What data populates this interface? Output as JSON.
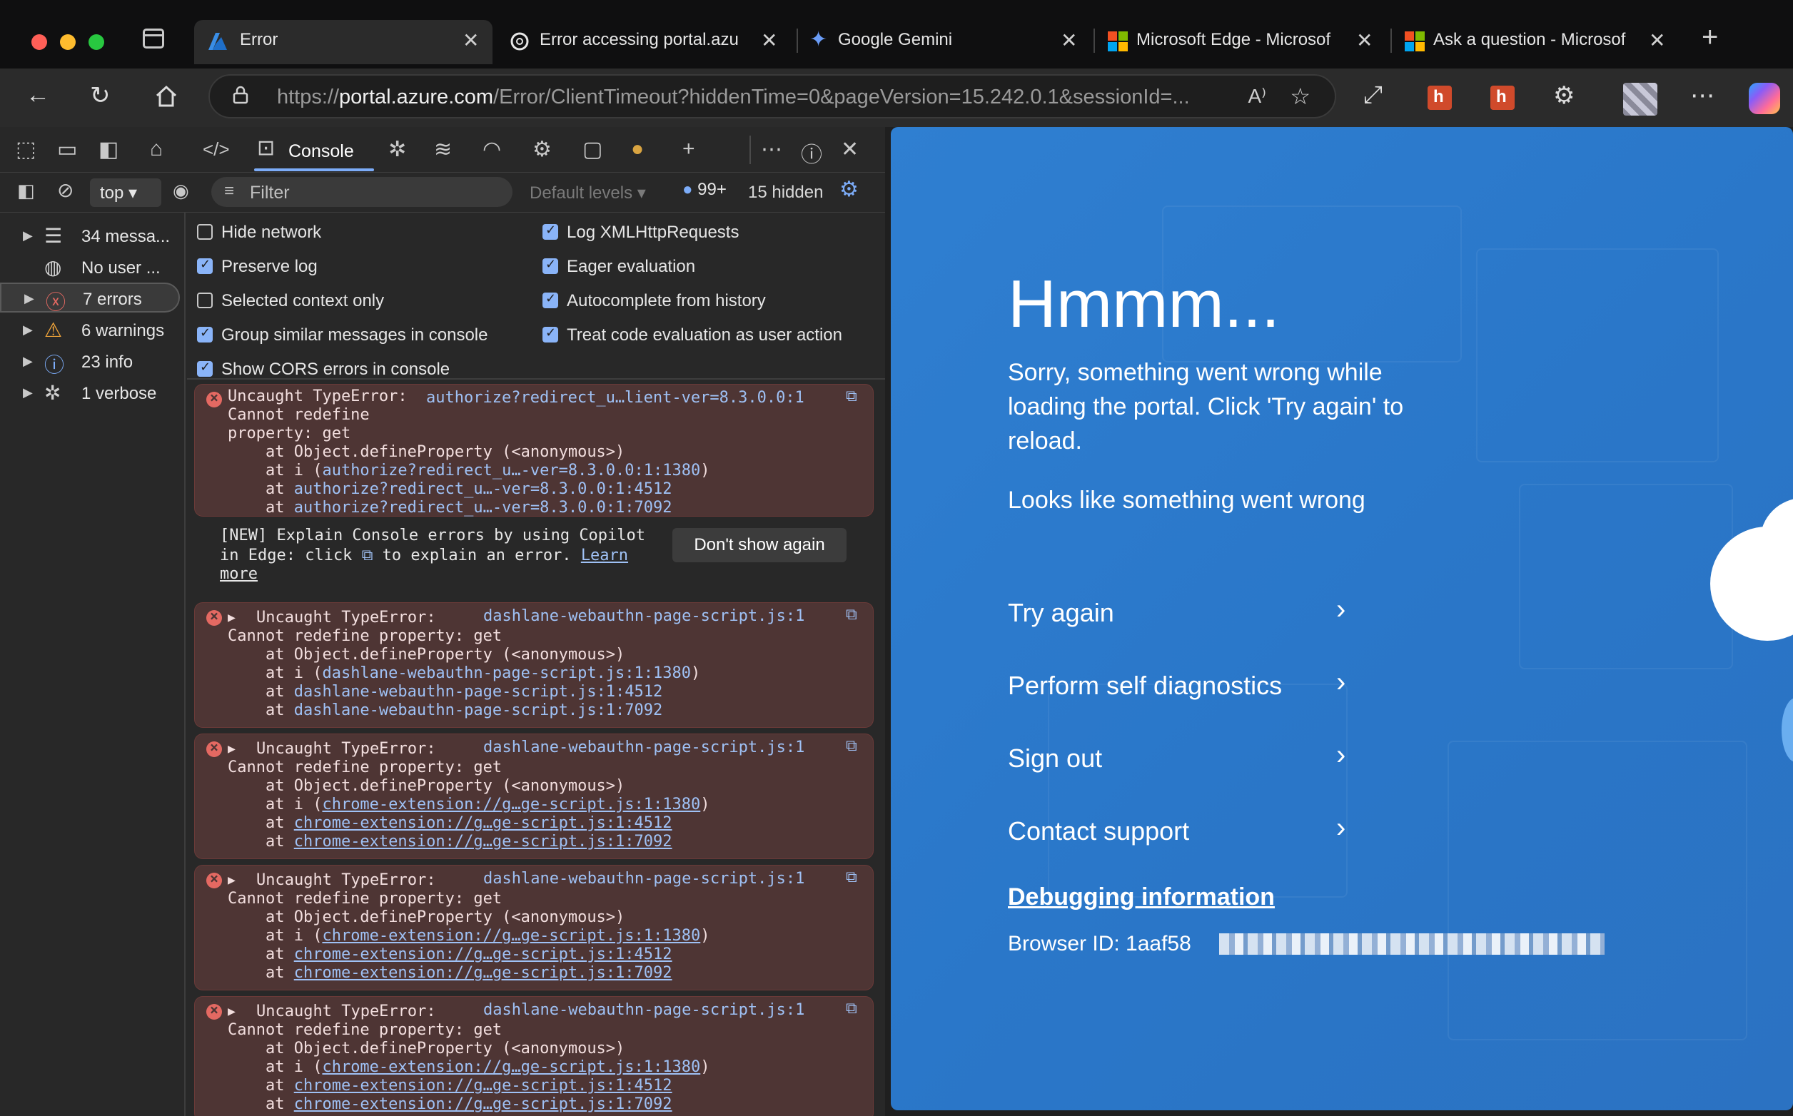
{
  "browser": {
    "tabs": [
      {
        "title": "Error",
        "active": true
      },
      {
        "title": "Error accessing portal.azu"
      },
      {
        "title": "Google Gemini"
      },
      {
        "title": "Microsoft Edge - Microsof"
      },
      {
        "title": "Ask a question - Microsof"
      }
    ],
    "url_scheme": "https://",
    "url_host": "portal.azure.com",
    "url_path": "/Error/ClientTimeout?hiddenTime=0&pageVersion=15.242.0.1&sessionId=..."
  },
  "devtools": {
    "active_tab": "Console",
    "context": "top",
    "filter_placeholder": "Filter",
    "levels": "Default levels",
    "issues_count": "99+",
    "hidden_count": "15 hidden",
    "sidebar": [
      {
        "label": "34 messa...",
        "icon": "list-icon"
      },
      {
        "label": "No user ...",
        "icon": "user-icon"
      },
      {
        "label": "7 errors",
        "icon": "error-icon",
        "selected": true
      },
      {
        "label": "6 warnings",
        "icon": "warning-icon"
      },
      {
        "label": "23 info",
        "icon": "info-icon"
      },
      {
        "label": "1 verbose",
        "icon": "bug-icon"
      }
    ],
    "settings_left": [
      {
        "label": "Hide network",
        "checked": false
      },
      {
        "label": "Preserve log",
        "checked": true
      },
      {
        "label": "Selected context only",
        "checked": false
      },
      {
        "label": "Group similar messages in console",
        "checked": true
      },
      {
        "label": "Show CORS errors in console",
        "checked": true
      }
    ],
    "settings_right": [
      {
        "label": "Log XMLHttpRequests",
        "checked": true
      },
      {
        "label": "Eager evaluation",
        "checked": true
      },
      {
        "label": "Autocomplete from history",
        "checked": true
      },
      {
        "label": "Treat code evaluation as user action",
        "checked": true
      }
    ],
    "first_error": {
      "l1": "Uncaught TypeError:",
      "l2": "Cannot redefine",
      "l3": "property: get",
      "src": "authorize?redirect_u…lient-ver=8.3.0.0:1",
      "s1": "    at Object.defineProperty (<anonymous>)",
      "s2a": "    at i (",
      "s2b": "authorize?redirect_u…-ver=8.3.0.0:1:1380",
      "s2c": ")",
      "s3a": "    at ",
      "s3b": "authorize?redirect_u…-ver=8.3.0.0:1:4512",
      "s4b": "authorize?redirect_u…-ver=8.3.0.0:1:7092"
    },
    "banner": {
      "l1": "[NEW] Explain Console errors by using Copilot",
      "l2a": "in Edge: click ",
      "l2b": " to explain an error. ",
      "learn": "Learn",
      "more": "more",
      "button": "Don't show again"
    },
    "errors": [
      {
        "head": "Uncaught TypeError:",
        "src": "dashlane-webauthn-page-script.js:1",
        "msg": "Cannot redefine property: get",
        "s1": "    at Object.defineProperty (<anonymous>)",
        "s2a": "    at i (",
        "s2b": "dashlane-webauthn-page-script.js:1:1380",
        "s3a": "    at ",
        "s3b": "dashlane-webauthn-page-script.js:1:4512",
        "s4b": "dashlane-webauthn-page-script.js:1:7092",
        "underline": false
      },
      {
        "head": "Uncaught TypeError:",
        "src": "dashlane-webauthn-page-script.js:1",
        "msg": "Cannot redefine property: get",
        "s1": "    at Object.defineProperty (<anonymous>)",
        "s2a": "    at i (",
        "s2b": "chrome-extension://g…ge-script.js:1:1380",
        "s3a": "    at ",
        "s3b": "chrome-extension://g…ge-script.js:1:4512",
        "s4b": "chrome-extension://g…ge-script.js:1:7092",
        "underline": true
      },
      {
        "head": "Uncaught TypeError:",
        "src": "dashlane-webauthn-page-script.js:1",
        "msg": "Cannot redefine property: get",
        "s1": "    at Object.defineProperty (<anonymous>)",
        "s2a": "    at i (",
        "s2b": "chrome-extension://g…ge-script.js:1:1380",
        "s3a": "    at ",
        "s3b": "chrome-extension://g…ge-script.js:1:4512",
        "s4b": "chrome-extension://g…ge-script.js:1:7092",
        "underline": true
      },
      {
        "head": "Uncaught TypeError:",
        "src": "dashlane-webauthn-page-script.js:1",
        "msg": "Cannot redefine property: get",
        "s1": "    at Object.defineProperty (<anonymous>)",
        "s2a": "    at i (",
        "s2b": "chrome-extension://g…ge-script.js:1:1380",
        "s3a": "    at ",
        "s3b": "chrome-extension://g…ge-script.js:1:4512",
        "s4b": "chrome-extension://g…ge-script.js:1:7092",
        "underline": true
      }
    ]
  },
  "portal": {
    "heading": "Hmmm...",
    "sorry": "Sorry, something went wrong while loading the portal. Click 'Try again' to reload.",
    "looks": "Looks like something went wrong",
    "actions": [
      "Try again",
      "Perform self diagnostics",
      "Sign out",
      "Contact support"
    ],
    "debugging": "Debugging information",
    "browser_id": "Browser ID: 1aaf58"
  },
  "colors": {
    "portal_blue": "#2f7fd1",
    "error_bg": "#4e3534",
    "link": "#9fc1f5",
    "accent": "#7cacf8"
  }
}
